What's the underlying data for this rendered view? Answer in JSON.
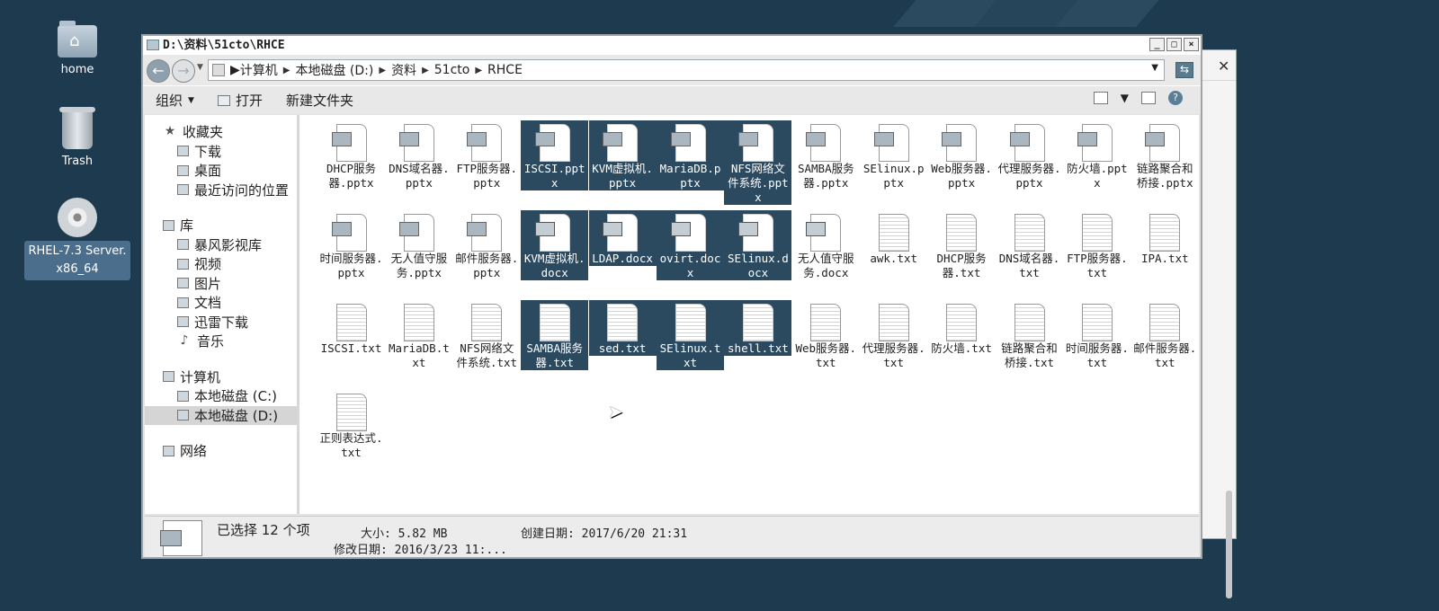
{
  "desktop": {
    "icons": [
      {
        "label": "home"
      },
      {
        "label": "Trash"
      },
      {
        "label": "RHEL-7.3 Server.\nx86_64"
      }
    ]
  },
  "window": {
    "title": "D:\\资料\\51cto\\RHCE",
    "buttons": {
      "min": "_",
      "max": "□",
      "close": "×"
    }
  },
  "address": {
    "crumbs": [
      "计算机",
      "本地磁盘 (D:)",
      "资料",
      "51cto",
      "RHCE"
    ]
  },
  "toolbar": {
    "organize": "组织",
    "open": "打开",
    "new_folder": "新建文件夹"
  },
  "nav": {
    "favorites": {
      "head": "收藏夹",
      "items": [
        "下载",
        "桌面",
        "最近访问的位置"
      ]
    },
    "libraries": {
      "head": "库",
      "items": [
        "暴风影视库",
        "视频",
        "图片",
        "文档",
        "迅雷下载",
        "音乐"
      ]
    },
    "computer": {
      "head": "计算机",
      "items": [
        "本地磁盘 (C:)",
        "本地磁盘 (D:)"
      ]
    },
    "network": {
      "head": "网络"
    }
  },
  "files": [
    {
      "name": "DHCP服务器.pptx",
      "type": "ppt",
      "selected": false
    },
    {
      "name": "DNS域名器.pptx",
      "type": "ppt",
      "selected": false
    },
    {
      "name": "FTP服务器.pptx",
      "type": "ppt",
      "selected": false
    },
    {
      "name": "ISCSI.pptx",
      "type": "ppt",
      "selected": true
    },
    {
      "name": "KVM虚拟机.pptx",
      "type": "ppt",
      "selected": true
    },
    {
      "name": "MariaDB.pptx",
      "type": "ppt",
      "selected": true
    },
    {
      "name": "NFS网络文件系统.pptx",
      "type": "ppt",
      "selected": true
    },
    {
      "name": "SAMBA服务器.pptx",
      "type": "ppt",
      "selected": false
    },
    {
      "name": "SElinux.pptx",
      "type": "ppt",
      "selected": false
    },
    {
      "name": "Web服务器.pptx",
      "type": "ppt",
      "selected": false
    },
    {
      "name": "代理服务器.pptx",
      "type": "ppt",
      "selected": false
    },
    {
      "name": "防火墙.pptx",
      "type": "ppt",
      "selected": false
    },
    {
      "name": "链路聚合和桥接.pptx",
      "type": "ppt",
      "selected": false
    },
    {
      "name": "时间服务器.pptx",
      "type": "ppt",
      "selected": false
    },
    {
      "name": "无人值守服务.pptx",
      "type": "ppt",
      "selected": false
    },
    {
      "name": "邮件服务器.pptx",
      "type": "ppt",
      "selected": false
    },
    {
      "name": "KVM虚拟机.docx",
      "type": "doc",
      "selected": true
    },
    {
      "name": "LDAP.docx",
      "type": "doc",
      "selected": true
    },
    {
      "name": "ovirt.docx",
      "type": "doc",
      "selected": true
    },
    {
      "name": "SElinux.docx",
      "type": "doc",
      "selected": true
    },
    {
      "name": "无人值守服务.docx",
      "type": "doc",
      "selected": false
    },
    {
      "name": "awk.txt",
      "type": "txt",
      "selected": false
    },
    {
      "name": "DHCP服务器.txt",
      "type": "txt",
      "selected": false
    },
    {
      "name": "DNS域名器.txt",
      "type": "txt",
      "selected": false
    },
    {
      "name": "FTP服务器.txt",
      "type": "txt",
      "selected": false
    },
    {
      "name": "IPA.txt",
      "type": "txt",
      "selected": false
    },
    {
      "name": "ISCSI.txt",
      "type": "txt",
      "selected": false
    },
    {
      "name": "MariaDB.txt",
      "type": "txt",
      "selected": false
    },
    {
      "name": "NFS网络文件系统.txt",
      "type": "txt",
      "selected": false
    },
    {
      "name": "SAMBA服务器.txt",
      "type": "txt",
      "selected": true
    },
    {
      "name": "sed.txt",
      "type": "txt",
      "selected": true
    },
    {
      "name": "SElinux.txt",
      "type": "txt",
      "selected": true
    },
    {
      "name": "shell.txt",
      "type": "txt",
      "selected": true
    },
    {
      "name": "Web服务器.txt",
      "type": "txt",
      "selected": false
    },
    {
      "name": "代理服务器.txt",
      "type": "txt",
      "selected": false
    },
    {
      "name": "防火墙.txt",
      "type": "txt",
      "selected": false
    },
    {
      "name": "链路聚合和桥接.txt",
      "type": "txt",
      "selected": false
    },
    {
      "name": "时间服务器.txt",
      "type": "txt",
      "selected": false
    },
    {
      "name": "邮件服务器.txt",
      "type": "txt",
      "selected": false
    },
    {
      "name": "正则表达式.txt",
      "type": "txt",
      "selected": false
    }
  ],
  "details": {
    "selected": "已选择 12 个项",
    "size": "大小: 5.82 MB",
    "created": "创建日期: 2017/6/20 21:31",
    "modified": "修改日期: 2016/3/23 11:..."
  },
  "colors": {
    "desktop": "#1e3a4f",
    "selection": "#2b4a60"
  }
}
